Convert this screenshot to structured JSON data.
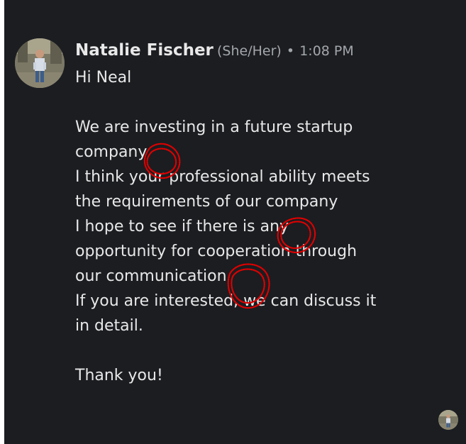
{
  "message": {
    "sender_name": "Natalie Fischer",
    "pronouns": "(She/Her)",
    "separator": "•",
    "timestamp": "1:08 PM",
    "lines": [
      "Hi Neal",
      "",
      "We are investing in a future startup",
      "company",
      "I think your professional ability meets",
      "the requirements of our company",
      "I hope to see if there is any",
      "opportunity for cooperation through",
      "our communication",
      "If you are interested, we can discuss it",
      "in detail.",
      "",
      "Thank you!"
    ]
  },
  "colors": {
    "background": "#1b1d21",
    "text": "#e8e8e8",
    "muted": "#a3a6ab",
    "annotation": "#e00000"
  },
  "icons": {
    "sender_avatar": "profile-photo",
    "read_receipt": "profile-photo-small"
  }
}
